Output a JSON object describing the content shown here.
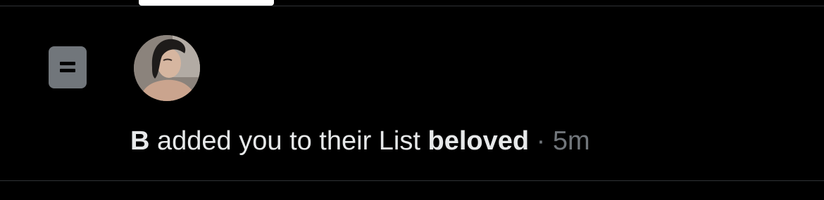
{
  "notification": {
    "icon": "list-icon",
    "actor_name": "B",
    "action_text": " added you to their List ",
    "list_name": "beloved",
    "separator": " · ",
    "time": "5m"
  },
  "colors": {
    "background": "#000000",
    "text_primary": "#e7e9ea",
    "text_secondary": "#71767b",
    "divider": "#2f3336"
  }
}
